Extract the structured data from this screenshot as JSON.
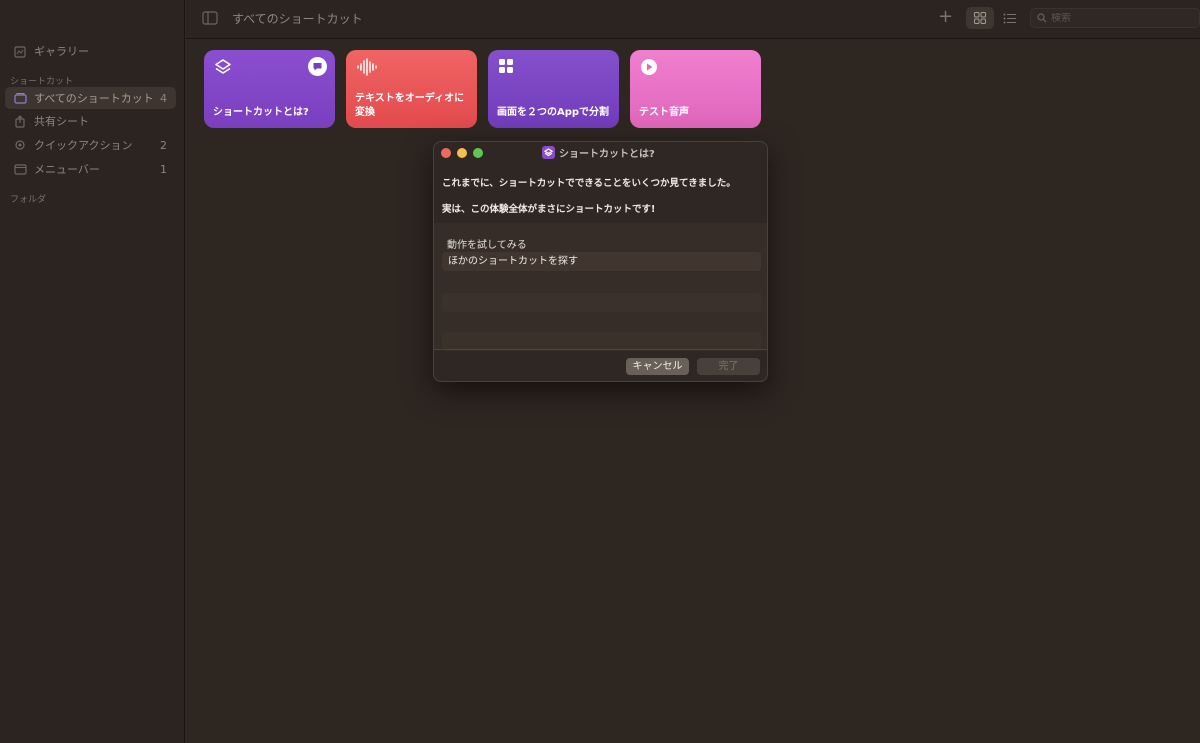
{
  "sidebar": {
    "gallery": "ギャラリー",
    "section_shortcuts": "ショートカット",
    "items": [
      {
        "label": "すべてのショートカット",
        "count": "4"
      },
      {
        "label": "共有シート",
        "count": ""
      },
      {
        "label": "クイックアクション",
        "count": "2"
      },
      {
        "label": "メニューバー",
        "count": "1"
      }
    ],
    "section_folders": "フォルダ"
  },
  "toolbar": {
    "title": "すべてのショートカット",
    "search_placeholder": "検索"
  },
  "cards": [
    {
      "label": "ショートカットとは?",
      "color": "#8a4cc9"
    },
    {
      "label": "テキストをオーディオに変換",
      "color": "#ef5a5a"
    },
    {
      "label": "画面を２つのAppで分割",
      "color": "#7c45c2"
    },
    {
      "label": "テスト音声",
      "color": "#e873c6"
    }
  ],
  "dialog": {
    "title": "ショートカットとは?",
    "message1": "これまでに、ショートカットでできることをいくつか見てきました。",
    "message2": "実は、この体験全体がまさにショートカットです!",
    "prompt": "動作を試してみる",
    "option1": "ほかのショートカットを探す",
    "cancel": "キャンセル",
    "done": "完了"
  }
}
